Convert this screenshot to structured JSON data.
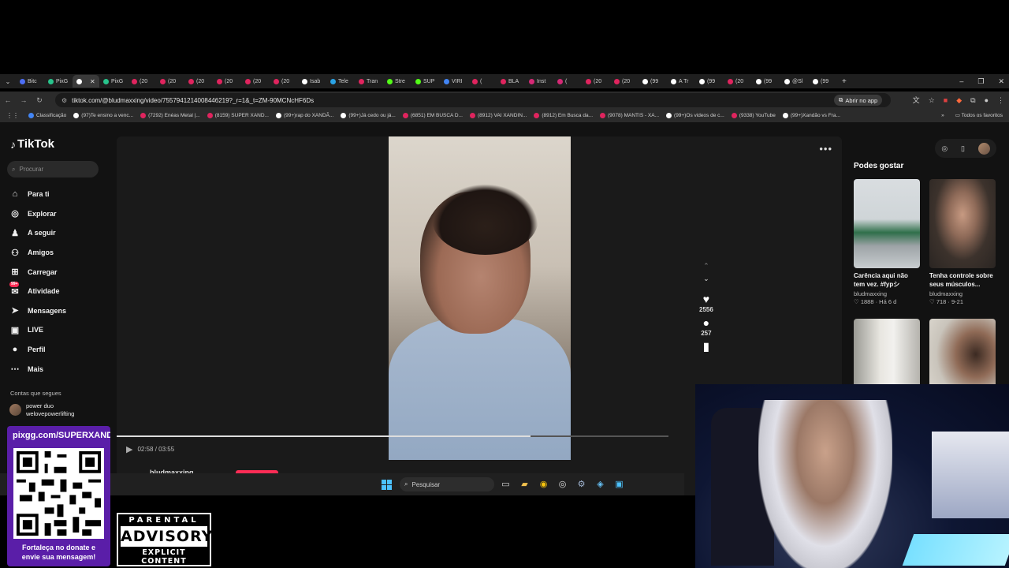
{
  "browser": {
    "tabs": [
      {
        "label": "Bitc",
        "color": "#4c6ef5"
      },
      {
        "label": "PixG",
        "color": "#28c48c"
      },
      {
        "label": "",
        "color": "#ffffff",
        "active": true
      },
      {
        "label": "PixG",
        "color": "#28c48c"
      },
      {
        "label": "(20",
        "color": "#e0245e"
      },
      {
        "label": "(20",
        "color": "#e0245e"
      },
      {
        "label": "(20",
        "color": "#e0245e"
      },
      {
        "label": "(20",
        "color": "#e0245e"
      },
      {
        "label": "(20",
        "color": "#e0245e"
      },
      {
        "label": "(20",
        "color": "#e0245e"
      },
      {
        "label": "Isab",
        "color": "#ffffff"
      },
      {
        "label": "Tele",
        "color": "#2aa3e6"
      },
      {
        "label": "Tran",
        "color": "#e0245e"
      },
      {
        "label": "Stre",
        "color": "#53fc18"
      },
      {
        "label": "SUP",
        "color": "#53fc18"
      },
      {
        "label": "VIRI",
        "color": "#4285f4"
      },
      {
        "label": "(",
        "color": "#e0245e"
      },
      {
        "label": "BLA",
        "color": "#e0245e"
      },
      {
        "label": "Inst",
        "color": "#d62976"
      },
      {
        "label": "(",
        "color": "#d62976"
      },
      {
        "label": "(20",
        "color": "#e0245e"
      },
      {
        "label": "(20",
        "color": "#e0245e"
      },
      {
        "label": "(99",
        "color": "#ffffff"
      },
      {
        "label": "A Tr",
        "color": "#ffffff"
      },
      {
        "label": "(99",
        "color": "#ffffff"
      },
      {
        "label": "(20",
        "color": "#e0245e"
      },
      {
        "label": "(99",
        "color": "#ffffff"
      },
      {
        "label": "@Sl",
        "color": "#ffffff"
      },
      {
        "label": "(99",
        "color": "#ffffff"
      }
    ],
    "url": "tiktok.com/@bludmaxxing/video/7557941214008446219?_r=1&_t=ZM-90MCNcHF6Ds",
    "open_app_label": "Abrir no app",
    "bookmarks": [
      {
        "label": "Classificação",
        "color": "#4285f4"
      },
      {
        "label": "(97)Te ensino a venc...",
        "color": "#ffffff"
      },
      {
        "label": "(7292) Enéas Metal |...",
        "color": "#e0245e"
      },
      {
        "label": "(8159) SUPER XAND...",
        "color": "#e0245e"
      },
      {
        "label": "(99+)rap do XANDÃ...",
        "color": "#ffffff"
      },
      {
        "label": "(99+)Já cedo ou já...",
        "color": "#ffffff"
      },
      {
        "label": "(6851) EM BUSCA D...",
        "color": "#e0245e"
      },
      {
        "label": "(8912) VAI XANDIN...",
        "color": "#e0245e"
      },
      {
        "label": "(8912) Em Busca da...",
        "color": "#e0245e"
      },
      {
        "label": "(9078) MANTIS - XA...",
        "color": "#e0245e"
      },
      {
        "label": "(99+)Os videos de c...",
        "color": "#ffffff"
      },
      {
        "label": "(9338) YouTube",
        "color": "#e0245e"
      },
      {
        "label": "(99+)Xandão vs Fra...",
        "color": "#ffffff"
      }
    ],
    "all_favorites": "Todos os favoritos"
  },
  "tiktok": {
    "logo": "TikTok",
    "search_placeholder": "Procurar",
    "menu": [
      {
        "label": "Para ti",
        "icon": "home-icon"
      },
      {
        "label": "Explorar",
        "icon": "compass-icon"
      },
      {
        "label": "A seguir",
        "icon": "following-icon"
      },
      {
        "label": "Amigos",
        "icon": "friends-icon"
      },
      {
        "label": "Carregar",
        "icon": "upload-icon"
      },
      {
        "label": "Atividade",
        "icon": "activity-icon",
        "badge": "99+"
      },
      {
        "label": "Mensagens",
        "icon": "messages-icon"
      },
      {
        "label": "LIVE",
        "icon": "live-icon"
      },
      {
        "label": "Perfil",
        "icon": "profile-icon"
      },
      {
        "label": "Mais",
        "icon": "more-icon"
      }
    ],
    "follows_title": "Contas que segues",
    "follow_account": {
      "name": "power duo",
      "handle": "welovepowerlifting"
    },
    "player": {
      "likes": "2556",
      "comments": "257",
      "time": "02:58 / 03:55",
      "progress": 0.75,
      "author": "bludmaxxing"
    },
    "suggest_title": "Podes gostar",
    "suggestions": [
      {
        "title": "Carência aqui não tem vez. #fypシ",
        "author": "bludmaxxing",
        "likes": "1888",
        "date": "Há 6 d"
      },
      {
        "title": "Tenha controle sobre seus músculos...",
        "author": "bludmaxxing",
        "likes": "718",
        "date": "9-21"
      },
      {
        "title": "",
        "author": "",
        "likes": "",
        "date": ""
      },
      {
        "title": "",
        "author": "",
        "likes": "",
        "date": ""
      }
    ]
  },
  "taskbar": {
    "search_placeholder": "Pesquisar"
  },
  "overlay": {
    "qr_link": "pixgg.com/SUPERXANDA",
    "qr_caption_1": "Fortaleça no donate e",
    "qr_caption_2": "envie sua mensagem!",
    "advisory_top": "PARENTAL",
    "advisory_mid": "ADVISORY",
    "advisory_bottom": "EXPLICIT CONTENT"
  },
  "colors": {
    "accent": "#fe2c55",
    "qr_panel": "#5a1ea8",
    "taskbar": "#202020"
  }
}
